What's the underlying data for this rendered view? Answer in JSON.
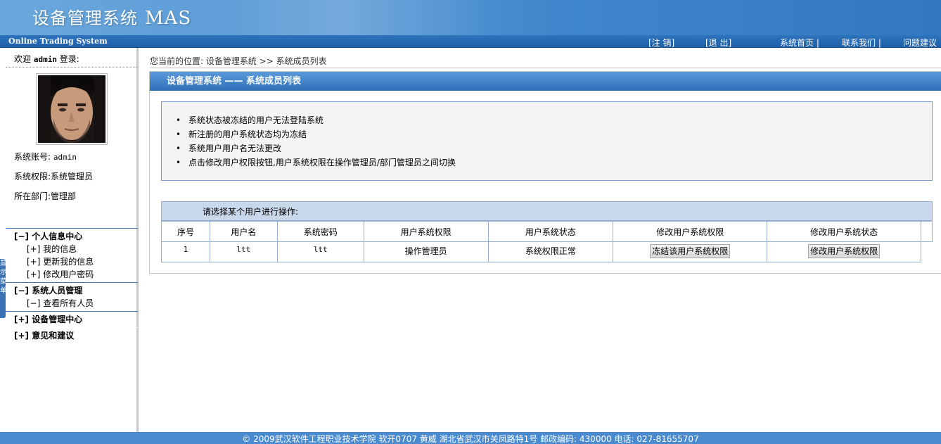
{
  "header": {
    "title": "设备管理系统",
    "title_suffix": "MAS",
    "subtitle": "Online Trading System"
  },
  "nav": {
    "logout": "[注 销]",
    "exit": "[退 出]",
    "home": "系统首页 |",
    "contact": "联系我们 |",
    "feedback": "问题建议"
  },
  "sidebar": {
    "welcome_prefix": "欢迎",
    "username": "admin",
    "welcome_suffix": "登录:",
    "account_label": "系统账号:",
    "account_value": "admin",
    "role_label": "系统权限:",
    "role_value": "系统管理员",
    "dept_label": "所在部门:",
    "dept_value": "管理部",
    "tab_text": "显示菜单"
  },
  "menu": {
    "personal": {
      "label": "[−] 个人信息中心",
      "items": [
        "[+] 我的信息",
        "[+] 更新我的信息",
        "[+] 修改用户密码"
      ]
    },
    "staff": {
      "label": "[−] 系统人员管理",
      "items": [
        "[−] 查看所有人员"
      ]
    },
    "device": {
      "label": "[+] 设备管理中心"
    },
    "suggest": {
      "label": "[+] 意见和建议"
    }
  },
  "breadcrumb": "您当前的位置: 设备管理系统 >> 系统成员列表",
  "panel_title": "设备管理系统 —— 系统成员列表",
  "notes": [
    "系统状态被冻结的用户无法登陆系统",
    "新注册的用户系统状态均为冻结",
    "系统用户用户名无法更改",
    "点击修改用户权限按钮,用户系统权限在操作管理员/部门管理员之间切换"
  ],
  "table": {
    "caption": "请选择某个用户进行操作:",
    "headers": [
      "序号",
      "用户名",
      "系统密码",
      "用户系统权限",
      "用户系统状态",
      "修改用户系统权限",
      "修改用户系统状态"
    ],
    "rows": [
      {
        "index": "1",
        "username": "ltt",
        "password": "ltt",
        "role": "操作管理员",
        "status": "系统权限正常",
        "action1": "冻结该用户系统权限",
        "action2": "修改用户系统权限"
      }
    ]
  },
  "footer": "© 2009武汉软件工程职业技术学院 软开0707 黄威 湖北省武汉市关凤路特1号 邮政编码: 430000 电话: 027-81655707"
}
